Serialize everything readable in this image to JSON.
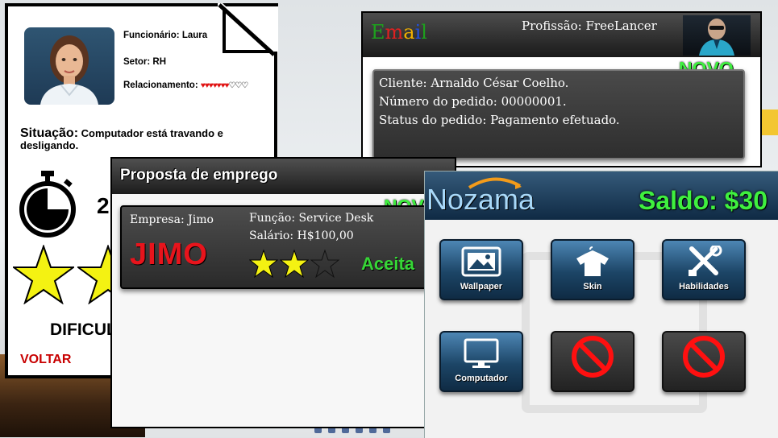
{
  "employee": {
    "name_line": "Funcionário: Laura",
    "sector_line": "Setor: RH",
    "relationship_label": "Relacionamento:",
    "relationship_filled": "♥♥♥♥♥♥♥",
    "relationship_empty": "♡♡♡",
    "situation_label": "Situação:",
    "situation_text": "Computador está travando e desligando.",
    "timer_digit": "2",
    "difficulty_label": "DIFICUL",
    "back_label": "VOLTAR"
  },
  "email": {
    "logo_letters": [
      "E",
      "m",
      "a",
      "i",
      "l"
    ],
    "logo_colors": [
      "#1da01d",
      "#e02020",
      "#f0b000",
      "#2050e0",
      "#1da01d"
    ],
    "profession": "Profissão: FreeLancer",
    "new_badge": "NOVO",
    "lines": [
      "Cliente: Arnaldo Césa r Coelho.",
      "Número do pedido: 00000001.",
      "Status do pedido: Pagamento efetuado."
    ]
  },
  "offer": {
    "title": "Proposta de emprego",
    "new_badge": "NOV",
    "company": "Empresa: Jimo",
    "role": "Função: Service Desk",
    "salary": "Salário: H$100,00",
    "company_logo": "JIMO",
    "stars_filled": 2,
    "stars_total": 3,
    "accept_label": "Aceita"
  },
  "store": {
    "logo": "Nozama",
    "balance": "Saldo: $30",
    "tiles": [
      {
        "label": "Wallpaper",
        "icon": "image-icon"
      },
      {
        "label": "Skin",
        "icon": "shirt-icon"
      },
      {
        "label": "Habilidades",
        "icon": "tools-icon"
      },
      {
        "label": "Computador",
        "icon": "monitor-icon"
      },
      {
        "label": "",
        "icon": "blocked-icon"
      },
      {
        "label": "",
        "icon": "blocked-icon"
      }
    ]
  },
  "colors": {
    "accent_green": "#3ff03f",
    "alert_red": "#c80000",
    "heart_red": "#e01010"
  }
}
